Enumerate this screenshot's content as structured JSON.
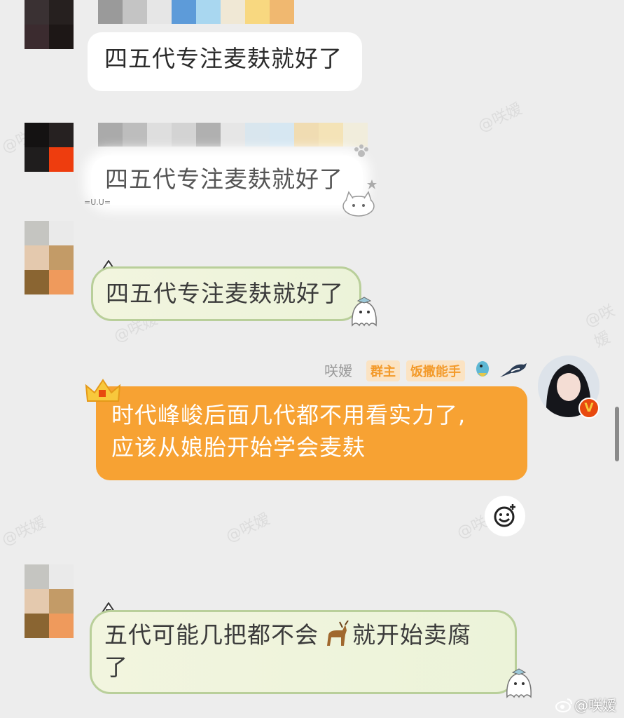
{
  "messages": [
    {
      "text": "四五代专注麦麸就好了"
    },
    {
      "text": "四五代专注麦麸就好了"
    },
    {
      "text": "四五代专注麦麸就好了"
    },
    {
      "sender": "咲嫒",
      "role_tag": "群主",
      "title_tag": "饭撒能手",
      "text_line1": "时代峰峻后面几代都不用看实力了,",
      "text_line2": "应该从娘胎开始学会麦麸"
    },
    {
      "text_part1": "五代可能几把都不会",
      "text_part2": "就开始卖腐",
      "text_line2": "了"
    }
  ],
  "watermark_footer": "@咲嫒",
  "watermarks": [
    "@咲嫒",
    "@咲嫒",
    "@咲嫒",
    "@咲嫒",
    "@咲嫒",
    "@咲嫒",
    "@咲嫒"
  ],
  "decor": {
    "cat_face": "=U.U="
  },
  "colors": {
    "accent_orange": "#f7a233",
    "tag_orange": "#f39a2a",
    "badge": "#e8490f"
  }
}
